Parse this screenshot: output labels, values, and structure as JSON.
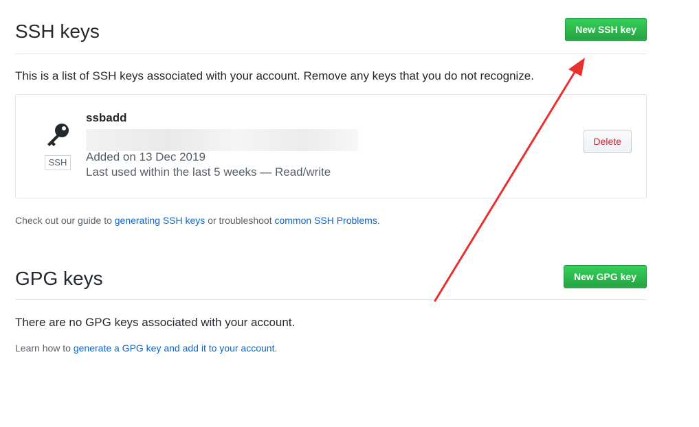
{
  "ssh": {
    "title": "SSH keys",
    "new_button": "New SSH key",
    "intro": "This is a list of SSH keys associated with your account. Remove any keys that you do not recognize.",
    "key": {
      "title": "ssbadd",
      "badge": "SSH",
      "added": "Added on 13 Dec 2019",
      "last_used": "Last used within the last 5 weeks — Read/write",
      "delete_label": "Delete"
    },
    "guide": {
      "prefix": "Check out our guide to ",
      "link1": "generating SSH keys",
      "middle": " or troubleshoot ",
      "link2": "common SSH Problems",
      "suffix": "."
    }
  },
  "gpg": {
    "title": "GPG keys",
    "new_button": "New GPG key",
    "empty": "There are no GPG keys associated with your account.",
    "learn": {
      "prefix": "Learn how to ",
      "link": "generate a GPG key and add it to your account",
      "suffix": "."
    }
  },
  "colors": {
    "primary_button": "#28a745",
    "danger_text": "#cb2431",
    "link": "#0366d6",
    "annotation_arrow": "#e8312f"
  }
}
